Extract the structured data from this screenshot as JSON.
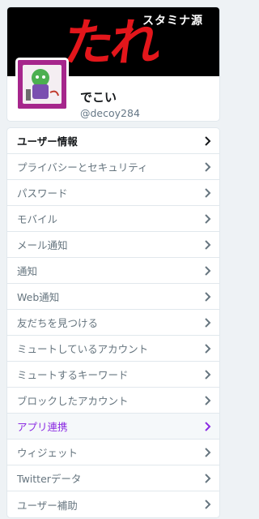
{
  "profile": {
    "banner_small_text": "スタミナ源",
    "banner_big_text": "たれ",
    "display_name": "でこい",
    "handle": "@decoy284"
  },
  "menu": {
    "items": [
      {
        "label": "ユーザー情報",
        "style": "bold"
      },
      {
        "label": "プライバシーとセキュリティ",
        "style": "normal"
      },
      {
        "label": "パスワード",
        "style": "normal"
      },
      {
        "label": "モバイル",
        "style": "normal"
      },
      {
        "label": "メール通知",
        "style": "normal"
      },
      {
        "label": "通知",
        "style": "normal"
      },
      {
        "label": "Web通知",
        "style": "normal"
      },
      {
        "label": "友だちを見つける",
        "style": "normal"
      },
      {
        "label": "ミュートしているアカウント",
        "style": "normal"
      },
      {
        "label": "ミュートするキーワード",
        "style": "normal"
      },
      {
        "label": "ブロックしたアカウント",
        "style": "normal"
      },
      {
        "label": "アプリ連携",
        "style": "active"
      },
      {
        "label": "ウィジェット",
        "style": "normal"
      },
      {
        "label": "Twitterデータ",
        "style": "normal"
      },
      {
        "label": "ユーザー補助",
        "style": "normal"
      }
    ],
    "chevron_icon": "chevron-right-icon"
  },
  "colors": {
    "accent": "#8b2be2",
    "banner_red": "#e3161b",
    "text_muted": "#66757f"
  }
}
